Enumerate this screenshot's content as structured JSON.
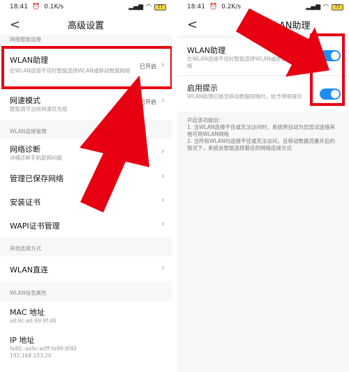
{
  "left": {
    "status": {
      "time": "18:41",
      "speed": "0.1K/s",
      "battery": "77"
    },
    "title": "高级设置",
    "section_smart": "网络智能连接",
    "wlan_assistant": {
      "label": "WLAN助理",
      "sub": "在WLAN连接不佳时智能选择WLAN或移动数据网络",
      "value": "已开启"
    },
    "network_mode": {
      "label": "网速模式",
      "sub": "智能调节当前网速优先级",
      "value": "已开启"
    },
    "section_manage": "WLAN连接管理",
    "diagnose": {
      "label": "网络诊断",
      "sub": "详细诊断手机联网问题"
    },
    "saved_networks": {
      "label": "管理已保存网络"
    },
    "install_cert": {
      "label": "安装证书"
    },
    "wapi_cert": {
      "label": "WAPI证书管理"
    },
    "section_other": "其他连接方式",
    "wlan_direct": {
      "label": "WLAN直连"
    },
    "section_info": "WLAN信息属性",
    "mac": {
      "label": "MAC 地址",
      "value": "a8:9c:ed:99:9f:40"
    },
    "ip": {
      "label": "IP 地址",
      "value1": "fe80::aa9c:edff:fe99:9f40",
      "value2": "192.168.103.20"
    }
  },
  "right": {
    "status": {
      "time": "18:41",
      "speed": "0.2K/s",
      "battery": "77"
    },
    "title": "WLAN助理",
    "assistant": {
      "label": "WLAN助理",
      "sub": "在WLAN连接不佳时智能选择WLAN或移动数据网络",
      "enabled": true
    },
    "prompt": {
      "label": "启用提示",
      "sub": "WLAN助理切换至移动数据网络时，给予弹框提示",
      "enabled": true
    },
    "note_title": "开启该功能后：",
    "note_1": "1. 当WLAN连接不佳或无法访问时，系统将自动为您尝试连接其他可用WLAN网络",
    "note_2": "2. 当所有WLAN均连接不佳或无法访问，且移动数据流量开启的情况下，系统会智能选择最佳的网络连接方式"
  },
  "colors": {
    "highlight": "#e60012",
    "toggle_on": "#1e8ef2"
  }
}
